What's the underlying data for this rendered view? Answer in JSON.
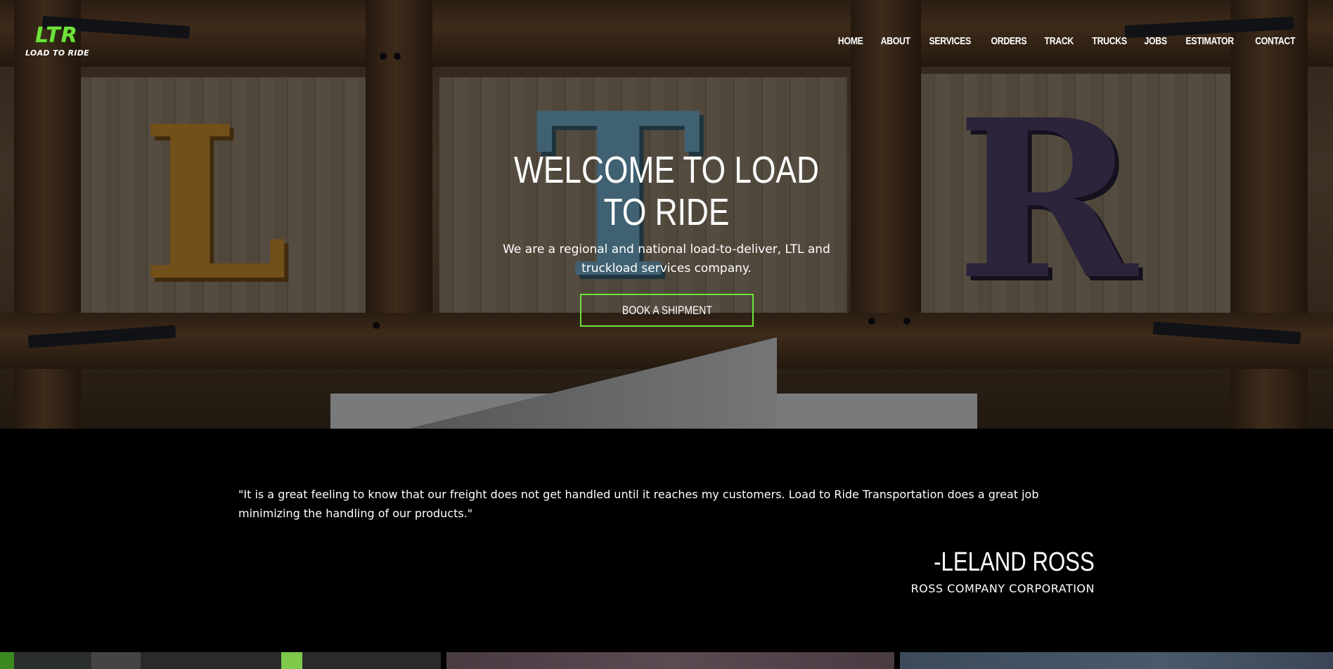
{
  "brand": {
    "logo_main": "LTR",
    "logo_sub": "LOAD TO RIDE"
  },
  "nav": {
    "items": [
      {
        "label": "HOME"
      },
      {
        "label": "ABOUT"
      },
      {
        "label": "SERVICES"
      },
      {
        "label": "ORDERS"
      },
      {
        "label": "TRACK"
      },
      {
        "label": "TRUCKS"
      },
      {
        "label": "JOBS"
      },
      {
        "label": "ESTIMATOR"
      },
      {
        "label": "CONTACT"
      }
    ]
  },
  "hero": {
    "title": "WELCOME TO LOAD TO RIDE",
    "text": "We are a regional and national load-to-deliver, LTL and truckload services company.",
    "cta_label": "BOOK A SHIPMENT"
  },
  "testimonial": {
    "quote": "\"It is a great feeling to know that our freight does not get handled until it reaches my customers. Load to Ride Transportation does a great job minimizing the handling of our products.\"",
    "author": "-LELAND ROSS",
    "company": "ROSS COMPANY CORPORATION"
  },
  "colors": {
    "accent": "#6ee33a",
    "background": "#000000",
    "text": "#ffffff"
  }
}
